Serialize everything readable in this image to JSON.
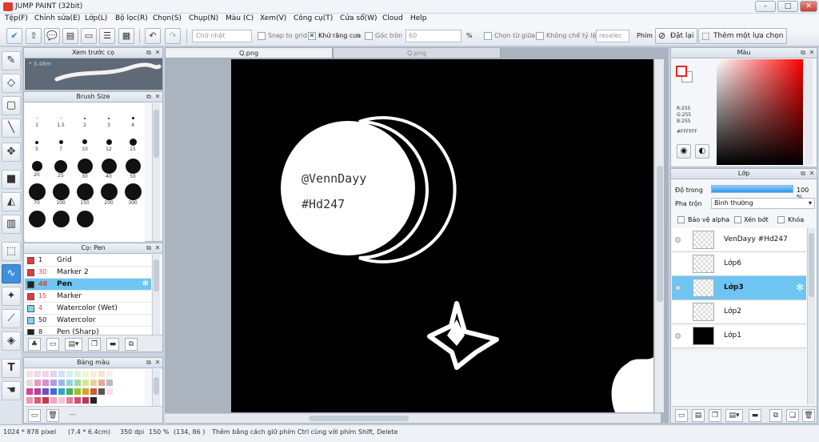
{
  "window": {
    "title": "JUMP PAINT (32bit)",
    "min": "–",
    "max": "□",
    "close": "✕"
  },
  "menu": [
    "Tệp(F)",
    "Chỉnh sửa(E)",
    "Lớp(L)",
    "Bộ lọc(R)",
    "Chọn(S)",
    "Chụp(N)",
    "Màu (C)",
    "Xem(V)",
    "Công cụ(T)",
    "Cửa sổ(W)",
    "Cloud",
    "Help"
  ],
  "toolbar": {
    "shape_select": "Chữ nhật",
    "snap_grid": "Snap to grid",
    "anti_alias": "Khử răng cưa",
    "anti_alias_mark": "✕",
    "round_corner": "Góc tròn",
    "round_value": "60",
    "percent": "%",
    "select_center": "Chọn từ giữa",
    "no_limit": "Không chế tỷ lệ",
    "reselect": "reselec",
    "key_label": "Phím",
    "reset_label": "Đặt lại",
    "add_selection": "Thêm một lựa chọn"
  },
  "panels": {
    "brush_preview": {
      "title": "Xem trước cọ",
      "size": "* 3.48m"
    },
    "brush_size": {
      "title": "Brush Size",
      "sizes": [
        "1",
        "1.5",
        "2",
        "3",
        "4",
        "5",
        "7",
        "10",
        "12",
        "15",
        "20",
        "25",
        "30",
        "40",
        "50",
        "70",
        "100",
        "150",
        "200",
        "300"
      ]
    },
    "pen_list": {
      "title": "Cọ: Pen",
      "items": [
        {
          "num": "1",
          "name": "Grid",
          "color": "#e83a3a"
        },
        {
          "num": "30",
          "name": "Marker 2",
          "color": "#e83a3a"
        },
        {
          "num": "48",
          "name": "Pen",
          "color": "#222222"
        },
        {
          "num": "15",
          "name": "Marker",
          "color": "#e83a3a"
        },
        {
          "num": "4",
          "name": "Watercolor (Wet)",
          "color": "#79d6f5"
        },
        {
          "num": "50",
          "name": "Watercolor",
          "color": "#79d6f5"
        },
        {
          "num": "8",
          "name": "Pen (Sharp)",
          "color": "#222222"
        }
      ]
    },
    "palette": {
      "title": "Bảng màu",
      "extra": "---"
    },
    "color": {
      "title": "Màu",
      "r": "R:255",
      "g": "G:255",
      "b": "B:255",
      "hex": "#FFFFFF"
    },
    "layers": {
      "title": "Lớp",
      "opacity_label": "Độ trong",
      "opacity_value": "100 %",
      "opacity": 1.0,
      "blend_label": "Pha trộn",
      "blend_value": "Bình thường",
      "protect_alpha": "Bảo vệ alpha",
      "clipping": "Xén bớt",
      "lock": "Khóa",
      "items": [
        "VenDayy #Hd247",
        "Lớp6",
        "Lớp3",
        "Lớp2",
        "Lớp1"
      ]
    }
  },
  "canvas": {
    "tabs": [
      "Q.png",
      "Q.png"
    ],
    "text1": "@VennDayy",
    "text2": "#Hd247"
  },
  "status": {
    "size": "1024 * 878 pixel",
    "cm": "(7.4 * 6.4cm)",
    "dpi": "350 dpi",
    "zoom": "150 %",
    "coords": "(134, 86 )",
    "hint": "Thêm bằng cách giữ phím Ctrl cùng với phím Shift, Delete"
  },
  "icons": {
    "tools": [
      "brush-icon",
      "eraser-icon",
      "rect-select-icon",
      "line-icon",
      "move-icon",
      "fill-rect-icon",
      "bucket-icon",
      "gradient-icon",
      "lasso-icon",
      "pen-tool-icon",
      "magic-wand-icon",
      "eyedropper-icon",
      "select-eraser-icon",
      "text-icon",
      "hand-icon"
    ]
  }
}
